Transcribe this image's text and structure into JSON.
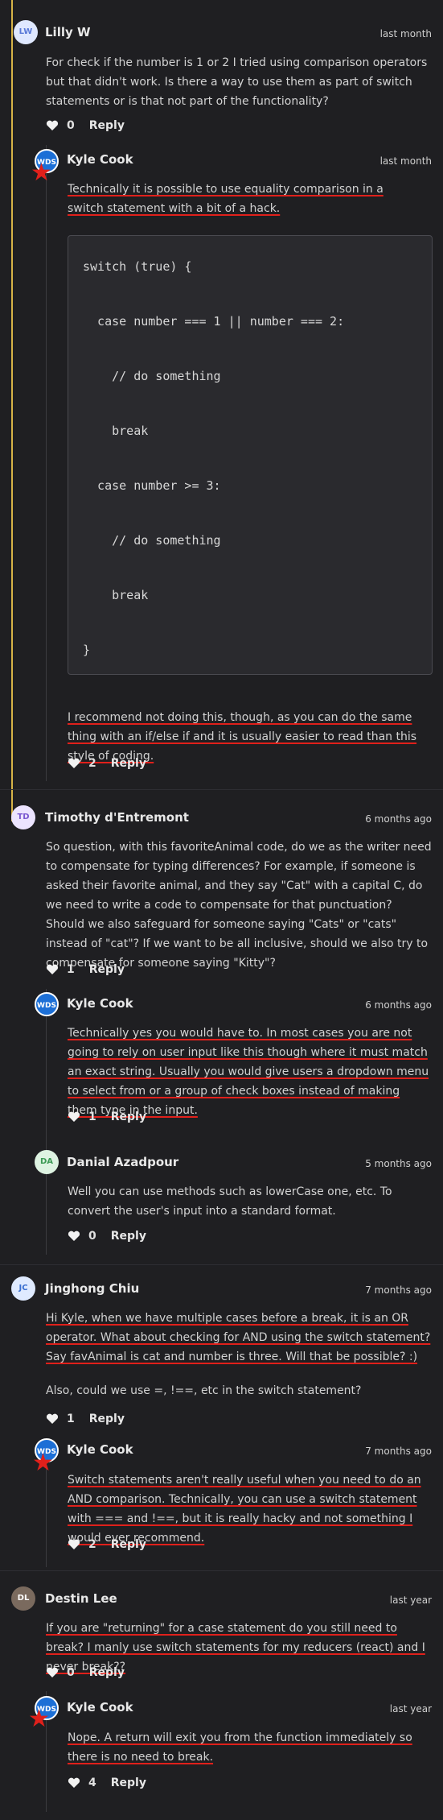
{
  "comments": [
    {
      "author": "Lilly W",
      "initials": "LW",
      "time": "last month",
      "text": "For check if the number is 1 or 2 I tried using comparison operators but that didn't work. Is there a way to use them as part of switch statements or is that not part of the functionality?",
      "likes": "0",
      "reply": "Reply",
      "replies": [
        {
          "author": "Kyle Cook",
          "initials": "WDS",
          "time": "last month",
          "text": "Technically it is possible to use equality comparison in a switch statement with a bit of a hack.",
          "code": [
            "switch (true) {",
            "  case number === 1 || number === 2:",
            "    // do something",
            "    break",
            "  case number >= 3:",
            "    // do something",
            "    break",
            "}"
          ],
          "text2": "I recommend not doing this, though, as you can do the same thing with an if/else if and it is usually easier to read than this style of coding.",
          "likes": "2",
          "reply": "Reply"
        }
      ]
    },
    {
      "author": "Timothy d'Entremont",
      "initials": "TD",
      "time": "6 months ago",
      "text": "So question, with this favoriteAnimal code, do we as the writer need to compensate for typing differences? For example, if someone is asked their favorite animal, and they say \"Cat\" with a capital C, do we need to write a code to compensate for that punctuation? Should we also safeguard for someone saying \"Cats\" or \"cats\" instead of \"cat\"? If we want to be all inclusive, should we also try to compensate for someone saying \"Kitty\"?",
      "likes": "1",
      "reply": "Reply",
      "replies": [
        {
          "author": "Kyle Cook",
          "initials": "WDS",
          "time": "6 months ago",
          "text": "Technically yes you would have to. In most cases you are not going to rely on user input like this though where it must match an exact string. Usually you would give users a dropdown menu to select from or a group of check boxes instead of making them type in the input.",
          "likes": "1",
          "reply": "Reply"
        },
        {
          "author": "Danial Azadpour",
          "initials": "DA",
          "time": "5 months ago",
          "text": "Well you can use methods such as lowerCase one, etc. To convert the user's input into a standard format.",
          "likes": "0",
          "reply": "Reply"
        }
      ]
    },
    {
      "author": "Jinghong Chiu",
      "initials": "JC",
      "time": "7 months ago",
      "text": "Hi Kyle, when we have multiple cases before a break, it is an OR operator. What about checking for AND using the switch statement? Say favAnimal is cat and number is three. Will that be possible? :)",
      "text2": "Also, could we use =, !==, etc in the switch statement?",
      "likes": "1",
      "reply": "Reply",
      "replies": [
        {
          "author": "Kyle Cook",
          "initials": "WDS",
          "time": "7 months ago",
          "text": "Switch statements aren't really useful when you need to do an AND comparison. Technically, you can use a switch statement with === and !==, but it is really hacky and not something I would ever recommend.",
          "likes": "2",
          "reply": "Reply"
        }
      ]
    },
    {
      "author": "Destin Lee",
      "initials": "DL",
      "time": "last year",
      "text": "If you are \"returning\" for a case statement do you still need to break? I manly use switch statements for my reducers (react) and I never break??",
      "likes": "0",
      "reply": "Reply",
      "replies": [
        {
          "author": "Kyle Cook",
          "initials": "WDS",
          "time": "last year",
          "text": "Nope. A return will exit you from the function immediately so there is no need to break.",
          "likes": "4",
          "reply": "Reply"
        }
      ]
    }
  ],
  "colors": {
    "background": "#1f1f22",
    "thread_accent": "#d6b347",
    "annotation": "#e0201b"
  },
  "icons": [
    "heart-icon",
    "wds-logo-icon"
  ]
}
